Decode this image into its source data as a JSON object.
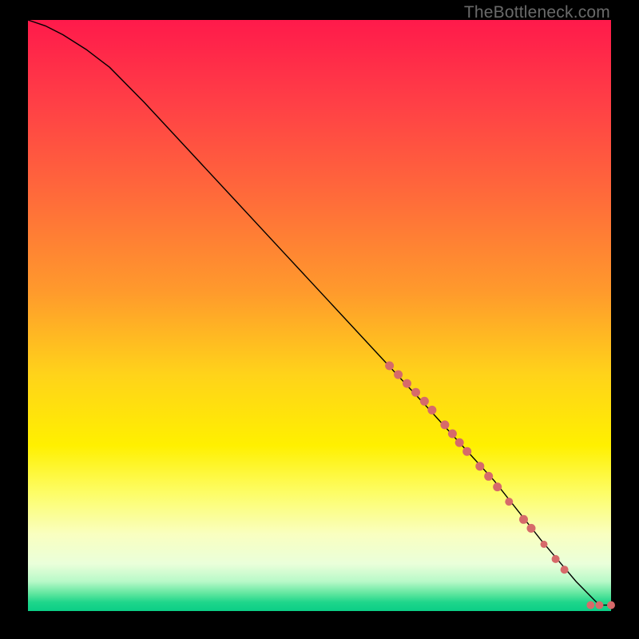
{
  "watermark": "TheBottleneck.com",
  "colors": {
    "frame_bg": "#000000",
    "curve": "#000000",
    "dot": "#d66a6a"
  },
  "gradient_stops": [
    {
      "pct": 0,
      "color": "#ff1a4b"
    },
    {
      "pct": 14,
      "color": "#ff3f46"
    },
    {
      "pct": 30,
      "color": "#ff6b3a"
    },
    {
      "pct": 46,
      "color": "#ff9a2c"
    },
    {
      "pct": 60,
      "color": "#ffd31a"
    },
    {
      "pct": 72,
      "color": "#fff000"
    },
    {
      "pct": 80,
      "color": "#fdfd66"
    },
    {
      "pct": 87,
      "color": "#f9ffc0"
    },
    {
      "pct": 92,
      "color": "#eaffda"
    },
    {
      "pct": 95,
      "color": "#b8f9c8"
    },
    {
      "pct": 97,
      "color": "#62e7a0"
    },
    {
      "pct": 98.5,
      "color": "#1fd68b"
    },
    {
      "pct": 100,
      "color": "#0bce86"
    }
  ],
  "chart_data": {
    "type": "line",
    "title": "",
    "xlabel": "",
    "ylabel": "",
    "xlim": [
      0,
      100
    ],
    "ylim": [
      0,
      100
    ],
    "series": [
      {
        "name": "bottleneck-curve",
        "x": [
          0,
          3,
          6,
          10,
          14,
          20,
          28,
          36,
          44,
          52,
          60,
          68,
          74,
          80,
          84,
          88,
          91,
          94,
          96.5,
          98,
          100
        ],
        "y": [
          100,
          99,
          97.5,
          95,
          92,
          86,
          77.5,
          69,
          60.5,
          52,
          43.5,
          35,
          28.5,
          22,
          17,
          12,
          8.5,
          5,
          2.5,
          1,
          1
        ]
      }
    ],
    "points": [
      {
        "x": 62.0,
        "y": 41.5,
        "r": 5.5
      },
      {
        "x": 63.5,
        "y": 40.0,
        "r": 5.5
      },
      {
        "x": 65.0,
        "y": 38.5,
        "r": 5.5
      },
      {
        "x": 66.5,
        "y": 37.0,
        "r": 5.5
      },
      {
        "x": 68.0,
        "y": 35.5,
        "r": 5.5
      },
      {
        "x": 69.3,
        "y": 34.0,
        "r": 5.5
      },
      {
        "x": 71.5,
        "y": 31.5,
        "r": 5.5
      },
      {
        "x": 72.8,
        "y": 30.0,
        "r": 5.5
      },
      {
        "x": 74.0,
        "y": 28.5,
        "r": 5.5
      },
      {
        "x": 75.3,
        "y": 27.0,
        "r": 5.5
      },
      {
        "x": 77.5,
        "y": 24.5,
        "r": 5.5
      },
      {
        "x": 79.0,
        "y": 22.8,
        "r": 5.5
      },
      {
        "x": 80.5,
        "y": 21.0,
        "r": 5.5
      },
      {
        "x": 82.5,
        "y": 18.5,
        "r": 5.0
      },
      {
        "x": 85.0,
        "y": 15.5,
        "r": 5.5
      },
      {
        "x": 86.3,
        "y": 14.0,
        "r": 5.5
      },
      {
        "x": 88.5,
        "y": 11.3,
        "r": 4.5
      },
      {
        "x": 90.5,
        "y": 8.8,
        "r": 5.0
      },
      {
        "x": 92.0,
        "y": 7.0,
        "r": 5.0
      },
      {
        "x": 96.5,
        "y": 1.0,
        "r": 5.0
      },
      {
        "x": 98.0,
        "y": 1.0,
        "r": 5.0
      },
      {
        "x": 100.0,
        "y": 1.0,
        "r": 5.0
      }
    ]
  }
}
